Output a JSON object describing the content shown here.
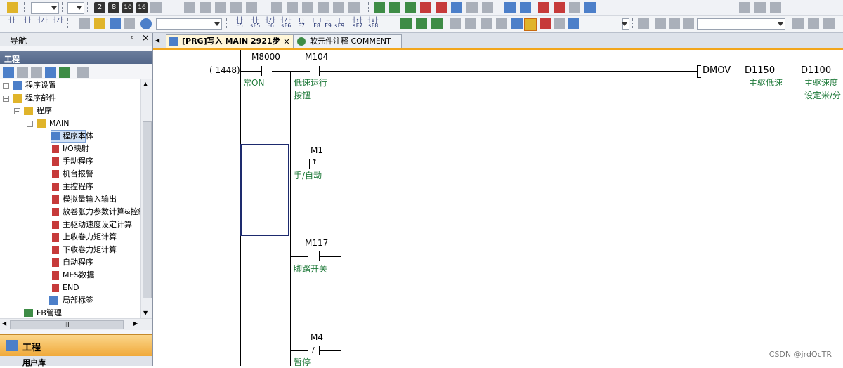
{
  "nav": {
    "title": "导航",
    "pin": "ᵖ",
    "close": "×",
    "project_header": "工程",
    "tree": [
      {
        "label": "程序设置",
        "level": 0,
        "expander": "+"
      },
      {
        "label": "程序部件",
        "level": 0,
        "expander": "−"
      },
      {
        "label": "程序",
        "level": 1,
        "expander": "−"
      },
      {
        "label": "MAIN",
        "level": 2,
        "expander": "−"
      },
      {
        "label": "程序本体",
        "level": 3,
        "selected": true
      },
      {
        "label": "I/O映射",
        "level": 3
      },
      {
        "label": "手动程序",
        "level": 3
      },
      {
        "label": "机台报警",
        "level": 3
      },
      {
        "label": "主控程序",
        "level": 3
      },
      {
        "label": "模拟量输入输出",
        "level": 3
      },
      {
        "label": "放卷张力参数计算&控制",
        "level": 3
      },
      {
        "label": "主驱动速度设定计算",
        "level": 3
      },
      {
        "label": "上收卷力矩计算",
        "level": 3
      },
      {
        "label": "下收卷力矩计算",
        "level": 3
      },
      {
        "label": "自动程序",
        "level": 3
      },
      {
        "label": "MES数据",
        "level": 3
      },
      {
        "label": "END",
        "level": 3
      },
      {
        "label": "局部标签",
        "level": 3
      },
      {
        "label": "FB管理",
        "level": 1
      }
    ],
    "bottom_tab_project": "工程",
    "bottom_tab_user_lib": "用户库",
    "hscroll_thumb": "III"
  },
  "tabs": [
    {
      "label": "[PRG]写入 MAIN 2921步",
      "active": true,
      "close": "×"
    },
    {
      "label": "软元件注释 COMMENT",
      "active": false
    }
  ],
  "ladder": {
    "step": "( 1448)",
    "contacts": [
      {
        "device": "M8000",
        "comment": [
          "常ON"
        ],
        "kind": "NO"
      },
      {
        "device": "M104",
        "comment": [
          "低速运行",
          "按钮"
        ],
        "kind": "NO"
      },
      {
        "device": "M1",
        "comment": [
          "手/自动"
        ],
        "kind": "rising"
      },
      {
        "device": "M117",
        "comment": [
          "脚踏开关"
        ],
        "kind": "NO"
      },
      {
        "device": "M4",
        "comment": [
          "暂停"
        ],
        "kind": "NC"
      }
    ],
    "instruction": {
      "op": "DMOV",
      "src": "D1150",
      "dst": "D1100",
      "src_comment": [
        "主驱低速"
      ],
      "dst_comment": [
        "主驱速度",
        "设定米/分"
      ]
    }
  },
  "toolbar": {
    "mode_combo": "",
    "device_numbers": [
      "2",
      "8",
      "10",
      "16"
    ],
    "ladder_keys": [
      "F5",
      "sF5",
      "F6",
      "sF6",
      "F7",
      "F8",
      "F9",
      "sF9",
      "sF7",
      "sF8"
    ]
  },
  "watermark": "CSDN @jrdQcTR",
  "colors": {
    "comment": "#1f7a3a",
    "active_tab": "#fff6d8",
    "accent": "#f2a61c"
  }
}
